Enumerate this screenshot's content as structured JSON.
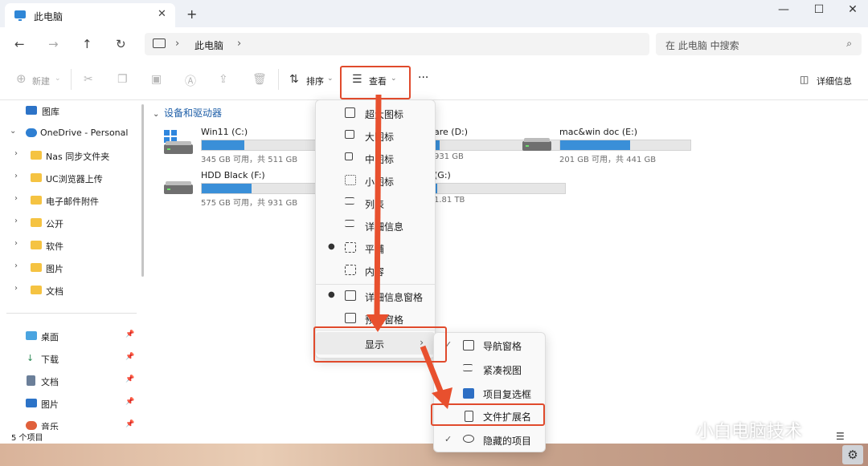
{
  "tab": {
    "title": "此电脑"
  },
  "window_controls": [
    "—",
    "☐",
    "✕"
  ],
  "address": {
    "path": "此电脑",
    "sep": "›",
    "search_placeholder": "在 此电脑 中搜索"
  },
  "toolbar": {
    "new": "新建",
    "sort": "排序",
    "view": "查看",
    "more": "···",
    "details": "详细信息"
  },
  "sidebar": {
    "items": [
      {
        "label": "图库",
        "icon": "gallery-icon"
      },
      {
        "label": "OneDrive - Personal",
        "icon": "cloud-icon"
      },
      {
        "label": "Nas 同步文件夹",
        "icon": "folder-icon"
      },
      {
        "label": "UC浏览器上传",
        "icon": "folder-icon"
      },
      {
        "label": "电子邮件附件",
        "icon": "folder-icon"
      },
      {
        "label": "公开",
        "icon": "folder-icon"
      },
      {
        "label": "软件",
        "icon": "folder-icon"
      },
      {
        "label": "图片",
        "icon": "folder-icon"
      },
      {
        "label": "文档",
        "icon": "folder-icon"
      }
    ],
    "quick": [
      {
        "label": "桌面",
        "icon": "desktop-icon"
      },
      {
        "label": "下载",
        "icon": "download-icon"
      },
      {
        "label": "文档",
        "icon": "document-icon"
      },
      {
        "label": "图片",
        "icon": "picture-icon"
      },
      {
        "label": "音乐",
        "icon": "music-icon"
      }
    ]
  },
  "main": {
    "group": "设备和驱动器",
    "drives": [
      {
        "name": "Win11 (C:)",
        "info": "345 GB 可用，共 511 GB",
        "used": 0.33
      },
      {
        "name": "are (D:)",
        "info": "931 GB",
        "used": 0.04
      },
      {
        "name": "mac&win doc (E:)",
        "info": "201 GB 可用，共 441 GB",
        "used": 0.54
      },
      {
        "name": "HDD Black (F:)",
        "info": "575 GB 可用，共 931 GB",
        "used": 0.38
      },
      {
        "name": "(G:)",
        "info": "1.81 TB",
        "used": 0.02
      }
    ]
  },
  "view_menu": {
    "items": [
      "超大图标",
      "大图标",
      "中图标",
      "小图标",
      "列表",
      "详细信息",
      "平铺",
      "内容",
      "详细信息窗格",
      "预览窗格",
      "显示"
    ]
  },
  "show_submenu": {
    "items": [
      "导航窗格",
      "紧凑视图",
      "项目复选框",
      "文件扩展名",
      "隐藏的项目"
    ]
  },
  "status": {
    "count": "5 个项目"
  },
  "watermark": "小白电脑技术",
  "accent": "#e04a2c"
}
